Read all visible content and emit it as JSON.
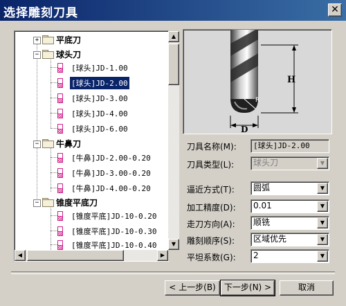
{
  "window": {
    "title": "选择雕刻刀具",
    "close_glyph": "✕"
  },
  "tree": {
    "groups": [
      {
        "label": "平底刀",
        "expander": "+",
        "items": []
      },
      {
        "label": "球头刀",
        "expander": "−",
        "items": [
          "[球头]JD-1.00",
          "[球头]JD-2.00",
          "[球头]JD-3.00",
          "[球头]JD-4.00",
          "[球头]JD-6.00"
        ]
      },
      {
        "label": "牛鼻刀",
        "expander": "−",
        "items": [
          "[牛鼻]JD-2.00-0.20",
          "[牛鼻]JD-3.00-0.20",
          "[牛鼻]JD-4.00-0.20"
        ]
      },
      {
        "label": "锥度平底刀",
        "expander": "−",
        "items": [
          "[锥度平底]JD-10-0.20",
          "[锥度平底]JD-10-0.30",
          "[锥度平底]JD-10-0.40"
        ]
      }
    ],
    "selected_item": "[球头]JD-2.00",
    "scroll_up": "▲",
    "scroll_down": "▼",
    "scroll_left": "◀",
    "scroll_right": "▶"
  },
  "preview": {
    "dim_height": "H",
    "dim_diameter": "D",
    "dim_radius": "R"
  },
  "tool_info": {
    "name_label": "刀具名称(M):",
    "name_value": "[球头]JD-2.00",
    "type_label": "刀具类型(L):",
    "type_value": "球头刀"
  },
  "params": [
    {
      "label": "逼近方式(T):",
      "value": "圆弧"
    },
    {
      "label": "加工精度(D):",
      "value": "0.01"
    },
    {
      "label": "走刀方向(A):",
      "value": "顺铣"
    },
    {
      "label": "雕刻顺序(S):",
      "value": "区域优先"
    },
    {
      "label": "平坦系数(G):",
      "value": "2"
    }
  ],
  "dropdown_glyph": "▼",
  "buttons": {
    "prev": "< 上一步(B)",
    "next": "下一步(N) >",
    "cancel": "取消"
  }
}
